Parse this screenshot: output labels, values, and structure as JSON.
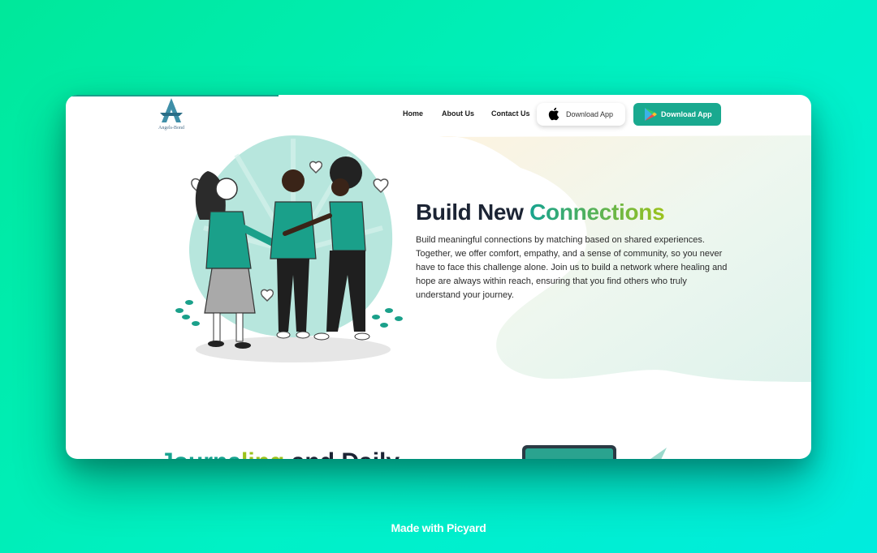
{
  "brand": {
    "logo_text": "Angels-Bond"
  },
  "nav": {
    "home": "Home",
    "about": "About Us",
    "contact": "Contact Us",
    "apple_button": "Download App",
    "play_button": "Download App"
  },
  "hero": {
    "title_part1": "Build New ",
    "title_part2": "Connections",
    "body": "Build meaningful connections by matching based on shared experiences. Together, we offer comfort, empathy, and a sense of community, so you never have to face this challenge alone. Join us to build a network where healing and hope are always within reach, ensuring that you find others who truly understand your journey."
  },
  "next_section": {
    "heading_part1": "Journa",
    "heading_part2": "ling",
    "heading_part3": " and Daily"
  },
  "footer": {
    "text": "Made with Picyard"
  },
  "colors": {
    "accent_teal": "#19a98f",
    "accent_lime": "#9cc21c",
    "text_dark": "#1c2434",
    "background_green": "#00ecb0"
  }
}
